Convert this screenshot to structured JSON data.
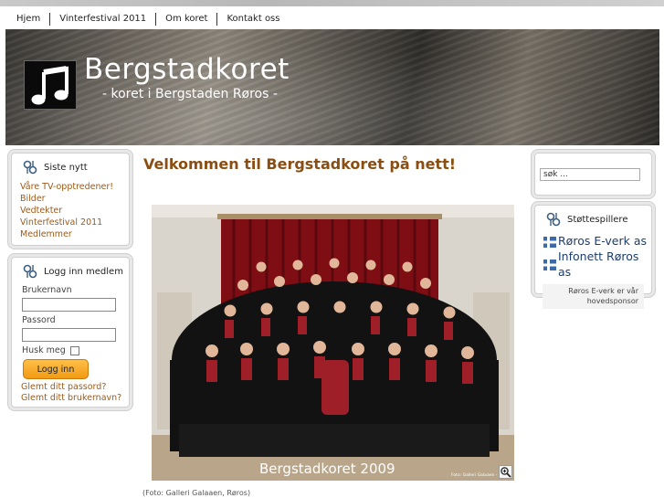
{
  "nav": {
    "items": [
      {
        "label": "Hjem"
      },
      {
        "label": "Vinterfestival 2011"
      },
      {
        "label": "Om koret"
      },
      {
        "label": "Kontakt oss"
      }
    ]
  },
  "header": {
    "title": "Bergstadkoret",
    "subtitle": "- koret i Bergstaden Røros -",
    "logo_icon": "music-notes-icon"
  },
  "left": {
    "news": {
      "title": "Siste nytt",
      "items": [
        {
          "label": "Våre TV-opptredener!"
        },
        {
          "label": "Bilder"
        },
        {
          "label": "Vedtekter"
        },
        {
          "label": "Vinterfestival 2011"
        },
        {
          "label": "Medlemmer"
        }
      ]
    },
    "login": {
      "title": "Logg inn medlem",
      "username_label": "Brukernavn",
      "username_value": "",
      "password_label": "Passord",
      "password_value": "",
      "remember_label": "Husk meg",
      "remember_checked": false,
      "button_label": "Logg inn",
      "forgot_password": "Glemt ditt passord?",
      "forgot_username": "Glemt ditt brukernavn?"
    }
  },
  "main": {
    "heading": "Velkommen til Bergstadkoret på nett!",
    "photo": {
      "overlay_text": "Bergstadkoret 2009",
      "credit_small": "Foto: Galleri Galaaen - Røros",
      "zoom_icon": "zoom-in-icon"
    },
    "caption": "(Foto: Galleri Galaaen, Røros)"
  },
  "right": {
    "search": {
      "value": "søk ..."
    },
    "sponsors": {
      "title": "Støttespillere",
      "items": [
        {
          "label": "Røros E-verk as"
        },
        {
          "label": "Infonett Røros as"
        }
      ],
      "note": "Røros E-verk er vår hovedsponsor"
    }
  },
  "colors": {
    "link": "#9b5a1a",
    "heading": "#8a4d12",
    "sponsor": "#1d3e6e",
    "button": "#f29b12"
  }
}
